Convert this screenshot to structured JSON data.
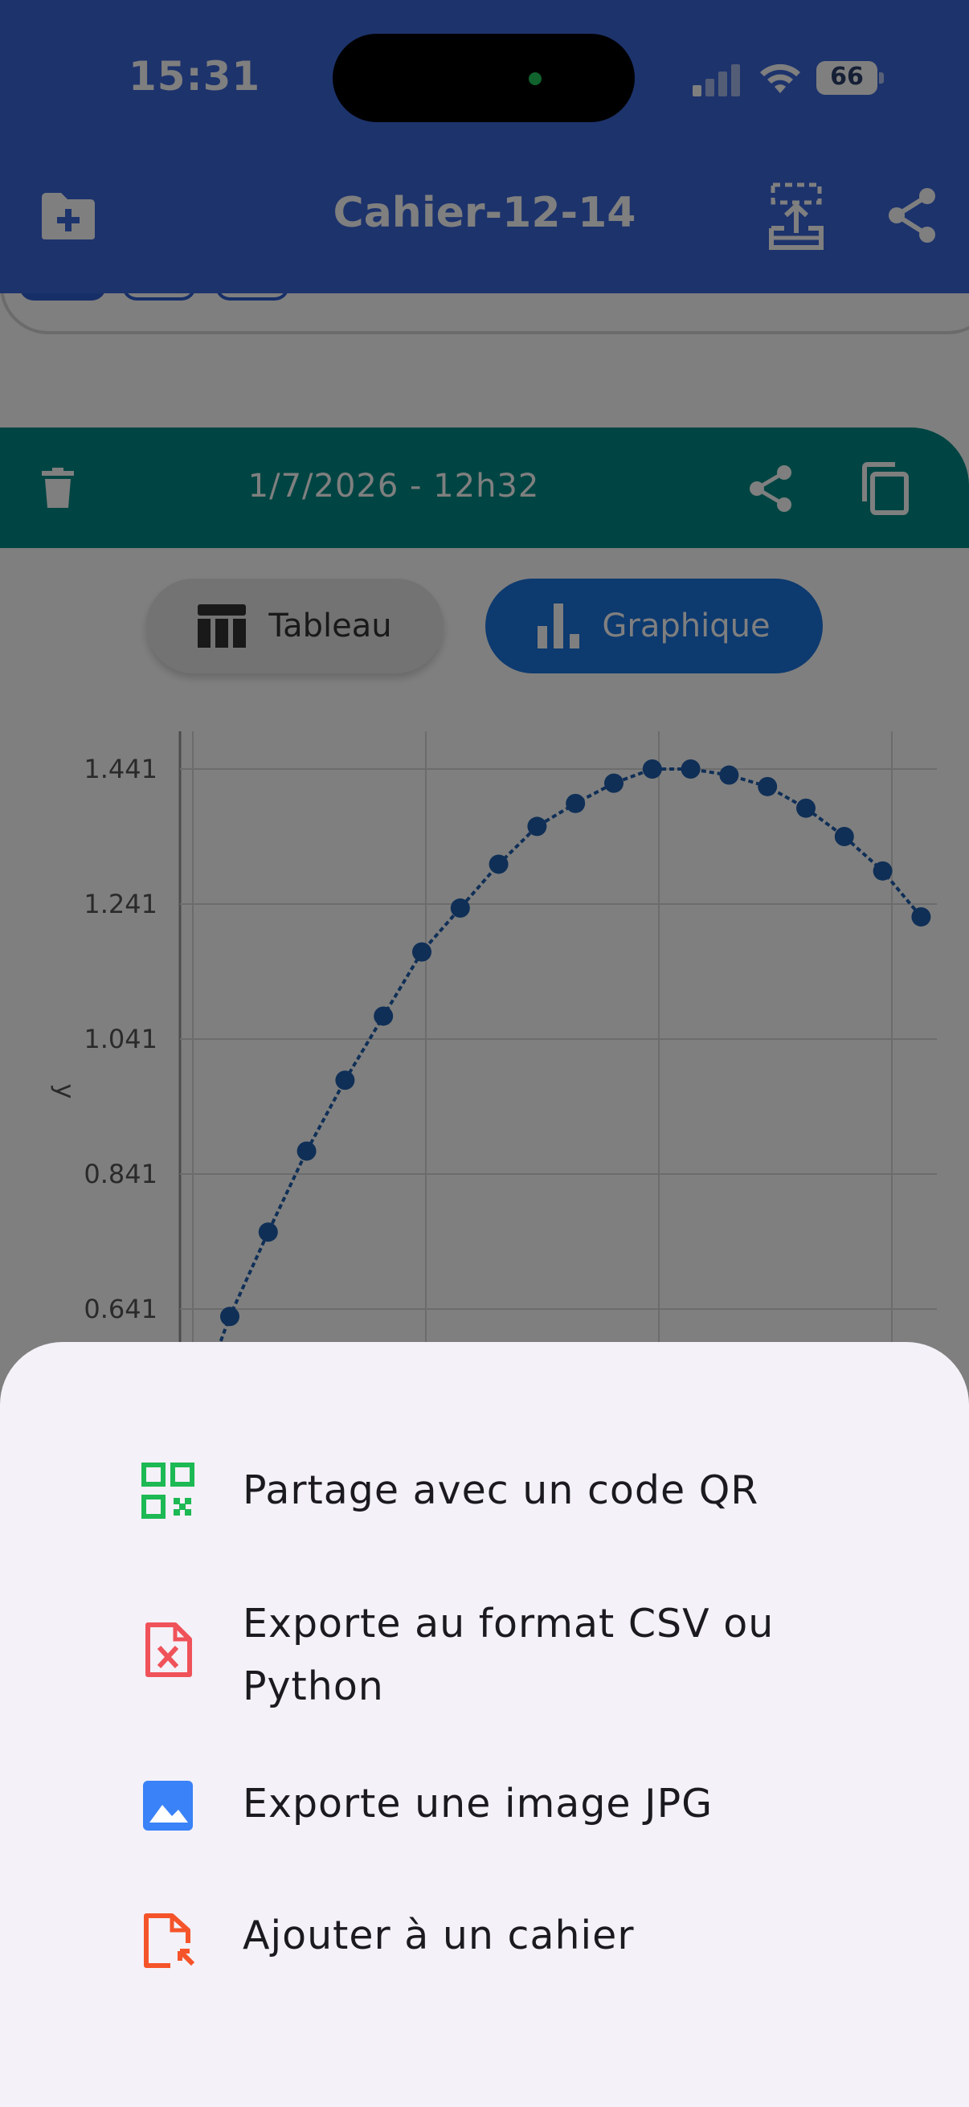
{
  "status_bar": {
    "time": "15:31",
    "battery": "66"
  },
  "app_bar": {
    "title": "Cahier-12-14"
  },
  "record": {
    "date": "1/7/2026 - 12h32"
  },
  "view_toggle": {
    "table_label": "Tableau",
    "graph_label": "Graphique",
    "selected": "Graphique"
  },
  "chart_data": {
    "type": "line",
    "ylabel": "y",
    "yticks": [
      "1.441",
      "1.241",
      "1.041",
      "0.841",
      "0.641"
    ],
    "grid": true,
    "markers": true,
    "series": [
      {
        "color": "#1f5fae",
        "x": [
          1,
          2,
          3,
          4,
          5,
          6,
          7,
          8,
          9,
          10,
          11,
          12,
          13,
          14,
          15,
          16,
          17,
          18,
          19
        ],
        "y": [
          0.63,
          0.755,
          0.875,
          0.98,
          1.075,
          1.17,
          1.235,
          1.3,
          1.356,
          1.39,
          1.42,
          1.441,
          1.441,
          1.432,
          1.415,
          1.383,
          1.341,
          1.29,
          1.222
        ]
      }
    ]
  },
  "share_sheet": {
    "items": [
      {
        "label": "Partage avec un code QR",
        "icon": "qr-code-icon",
        "color": "#1db954"
      },
      {
        "label": "Exporte au format CSV ou Python",
        "icon": "csv-file-icon",
        "color": "#f0525a"
      },
      {
        "label": "Exporte une image JPG",
        "icon": "image-icon",
        "color": "#3a82f7"
      },
      {
        "label": "Ajouter à un cahier",
        "icon": "add-to-notebook-icon",
        "color": "#f5542a"
      }
    ]
  }
}
